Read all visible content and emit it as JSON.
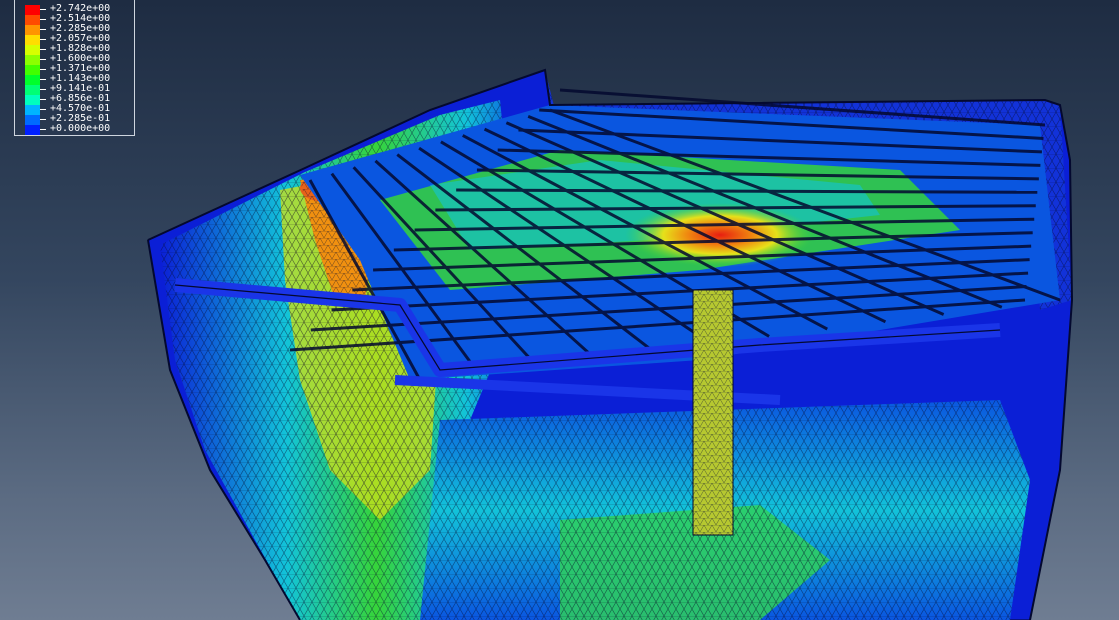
{
  "legend": {
    "levels": [
      {
        "label": "+2.742e+00",
        "color": "#ff0000"
      },
      {
        "label": "+2.514e+00",
        "color": "#ff4a00"
      },
      {
        "label": "+2.285e+00",
        "color": "#ff9400"
      },
      {
        "label": "+2.057e+00",
        "color": "#ffdd00"
      },
      {
        "label": "+1.828e+00",
        "color": "#d6ff00"
      },
      {
        "label": "+1.600e+00",
        "color": "#8cff00"
      },
      {
        "label": "+1.371e+00",
        "color": "#42ff00"
      },
      {
        "label": "+1.143e+00",
        "color": "#00ff2a"
      },
      {
        "label": "+9.141e-01",
        "color": "#00ff74"
      },
      {
        "label": "+6.856e-01",
        "color": "#00ffbe"
      },
      {
        "label": "+4.570e-01",
        "color": "#00b4ff"
      },
      {
        "label": "+2.285e-01",
        "color": "#006aff"
      },
      {
        "label": "+0.000e+00",
        "color": "#0020ff"
      }
    ]
  },
  "model_colors": {
    "low": "#0b1fd6",
    "low_mid": "#0a56e0",
    "mid_cyan": "#12c3d9",
    "mid_green": "#36d43a",
    "yellow": "#e6e11a",
    "orange": "#f08a10",
    "red": "#e81e10",
    "edge": "#04092f"
  }
}
